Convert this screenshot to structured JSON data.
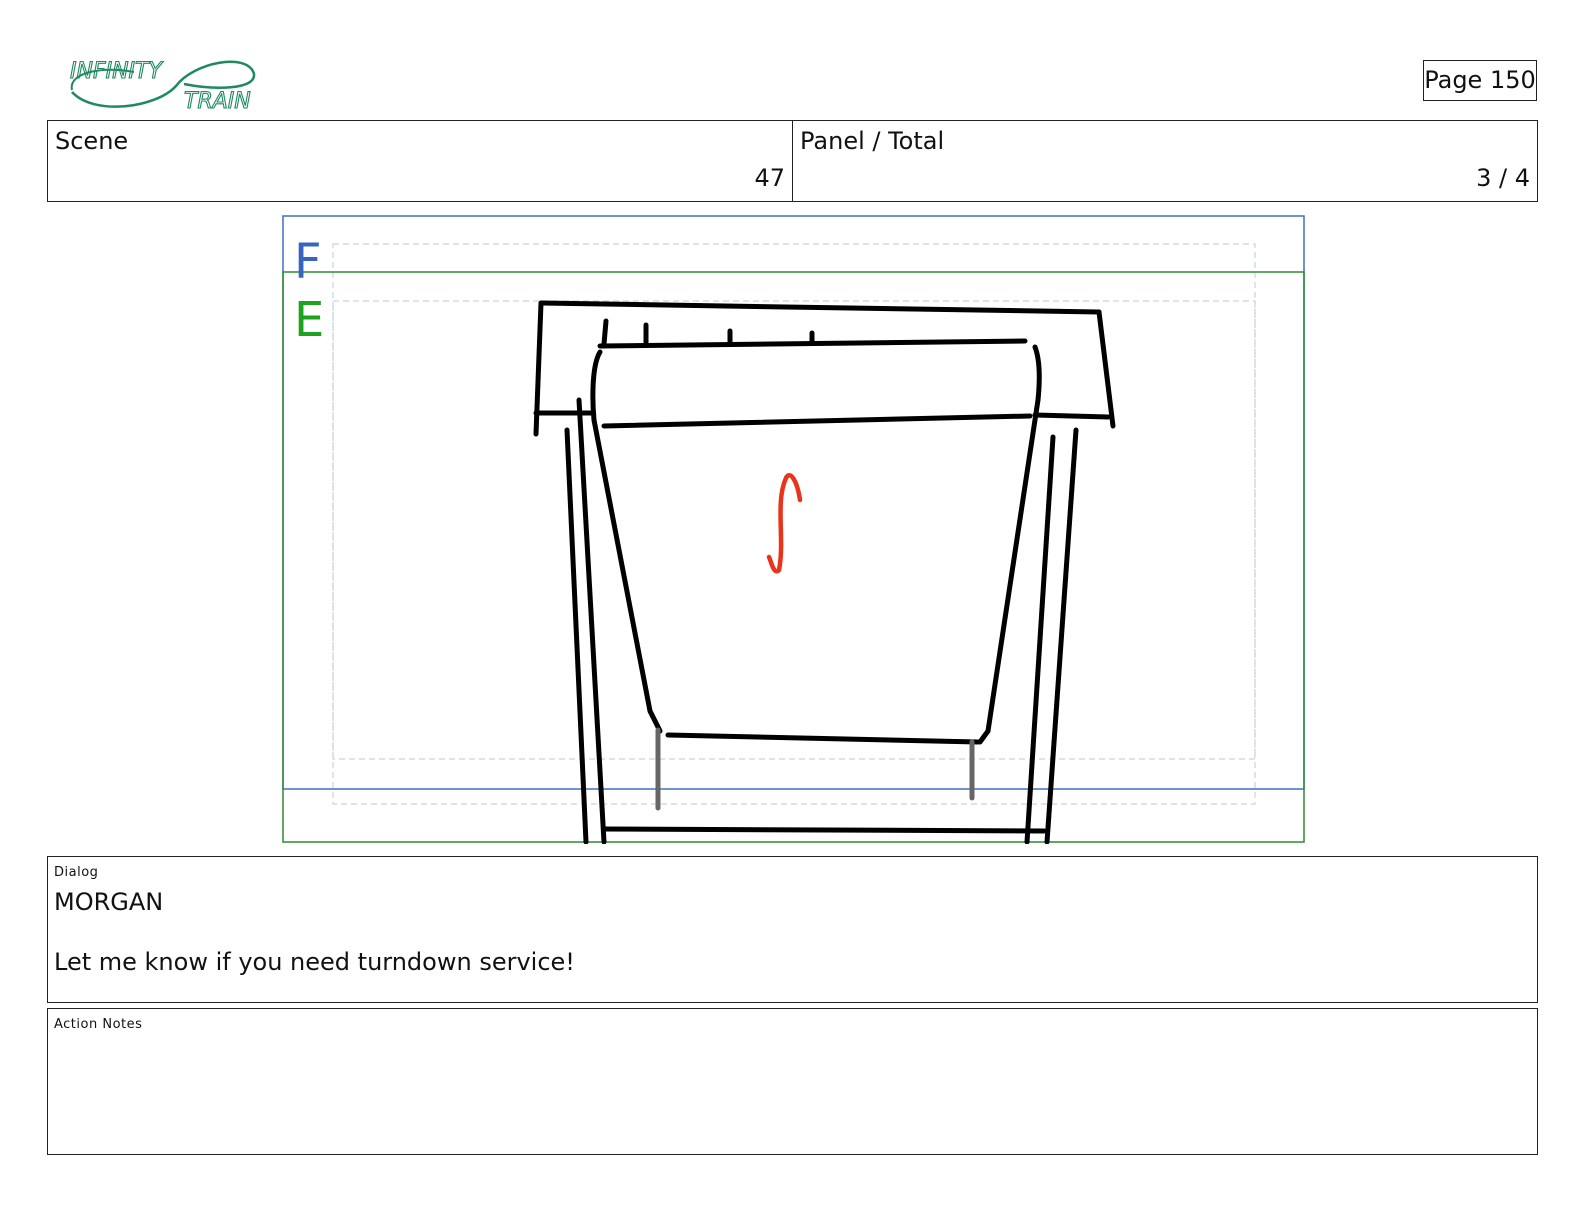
{
  "header": {
    "logo": {
      "line1": "INFINITY",
      "line2": "TRAIN"
    },
    "page_label": "Page 150",
    "scene_label": "Scene",
    "scene_value": "47",
    "panel_label": "Panel / Total",
    "panel_value": "3 / 4"
  },
  "panel": {
    "frame_labels": {
      "outer": "F",
      "inner": "E"
    },
    "colors": {
      "outer_frame": "#3f6fc6",
      "inner_frame": "#2e8b2e",
      "letter_outer": "#3565c0",
      "letter_inner": "#1fa31f",
      "motion_arrow": "#e8341a",
      "sketch": "#000000"
    }
  },
  "dialog": {
    "label": "Dialog",
    "character": "MORGAN",
    "line": "Let me know if you need turndown service!"
  },
  "action_notes": {
    "label": "Action Notes",
    "text": ""
  }
}
